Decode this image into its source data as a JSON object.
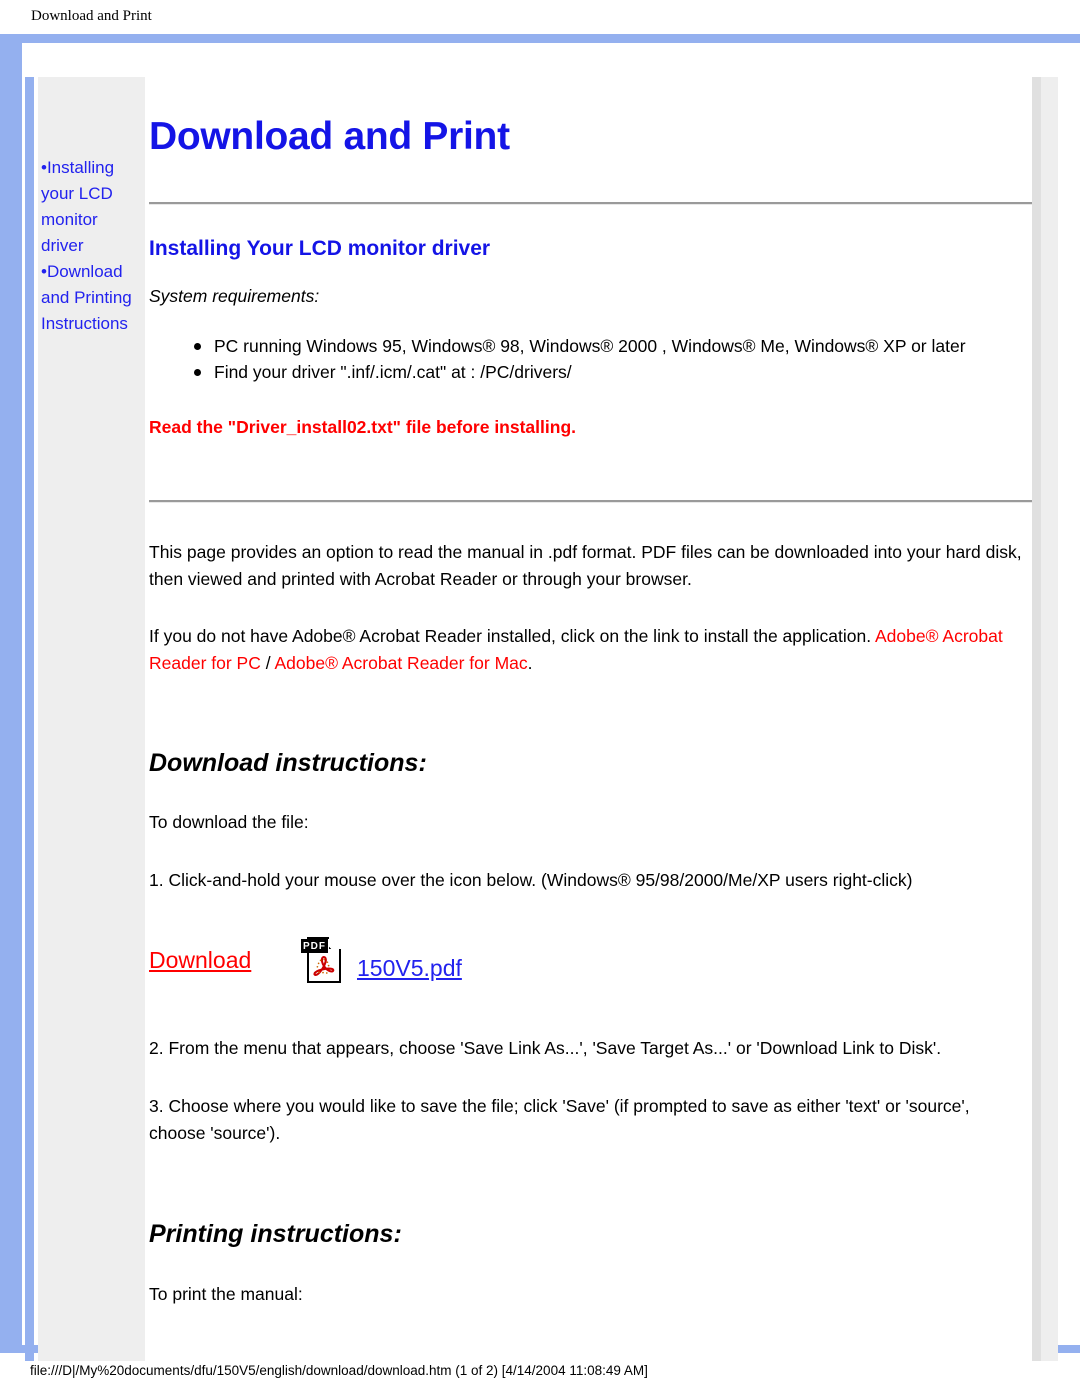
{
  "print_header": {
    "title": "Download and Print"
  },
  "print_footer": {
    "path": "file:///D|/My%20documents/dfu/150V5/english/download/download.htm (1 of 2) [4/14/2004 11:08:49 AM]"
  },
  "colors": {
    "frame_blue": "#94b0ef",
    "link_blue": "#2222ee",
    "heading_blue": "#1414e6",
    "alert_red": "#ff0000",
    "sidebar_gray": "#eeeeee"
  },
  "sidebar": {
    "items": [
      {
        "bullet": "•",
        "label": "Installing your LCD monitor driver"
      },
      {
        "bullet": "•",
        "label": "Download and Printing Instructions"
      }
    ]
  },
  "main": {
    "page_title": "Download and Print",
    "section_title": "Installing Your LCD monitor driver",
    "system_requirements_label": "System requirements:",
    "requirements": [
      "PC running Windows 95, Windows® 98, Windows® 2000 , Windows® Me, Windows® XP or later",
      "Find your driver \".inf/.icm/.cat\" at : /PC/drivers/"
    ],
    "warning": "Read the \"Driver_install02.txt\" file before installing.",
    "paragraph_1": "This page provides an option to read the manual in .pdf format. PDF files can be downloaded into your hard disk, then viewed and printed with Acrobat Reader or through your browser.",
    "paragraph_2_prefix": "If you do not have Adobe® Acrobat Reader installed, click on the link to install the application. ",
    "link_pc": "Adobe® Acrobat Reader for PC",
    "link_separator": " / ",
    "link_mac": "Adobe® Acrobat Reader for Mac",
    "paragraph_2_suffix": ".",
    "download_instructions_title": "Download instructions:",
    "download_intro": "To download the file:",
    "step_1": "1. Click-and-hold your mouse over the icon below. (Windows® 95/98/2000/Me/XP users right-click)",
    "download_link_label": "Download",
    "pdf_icon_label": "PDF",
    "pdf_filename": "150V5.pdf",
    "step_2": "2. From the menu that appears, choose 'Save Link As...', 'Save Target As...' or 'Download Link to Disk'.",
    "step_3": "3. Choose where you would like to save the file; click 'Save' (if prompted to save as either 'text' or 'source', choose 'source').",
    "printing_instructions_title": "Printing instructions:",
    "printing_intro": "To print the manual:"
  }
}
